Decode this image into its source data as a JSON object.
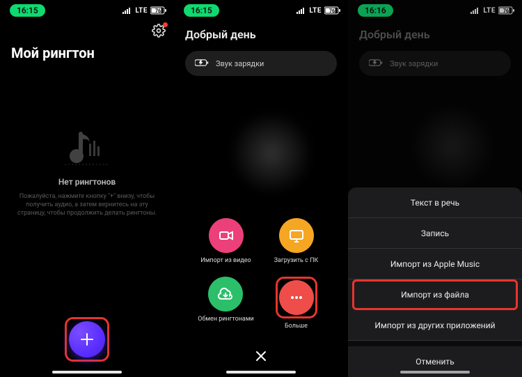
{
  "status": {
    "time_s1": "16:15",
    "time_s2": "16:15",
    "time_s3": "16:16",
    "signal": "••••",
    "net": "LTE",
    "battery": "76"
  },
  "screen1": {
    "title": "Мой рингтон",
    "empty_title": "Нет рингтонов",
    "empty_body": "Пожалуйста, нажмите кнопку \"+\" внизу, чтобы получить аудио, а затем вернитесь на эту страницу, чтобы продолжить делать рингтоны."
  },
  "screen2": {
    "greeting": "Добрый день",
    "chip_label": "Звук зарядки",
    "actions": {
      "video": "Импорт из видео",
      "pc": "Загрузить с ПК",
      "share": "Обмен рингтонами",
      "more": "Больше"
    }
  },
  "screen3": {
    "greeting": "Добрый день",
    "chip_label": "Звук зарядки",
    "sheet": {
      "tts": "Текст в речь",
      "record": "Запись",
      "apple_music": "Импорт из Apple Music",
      "file": "Импорт из файла",
      "other_apps": "Импорт из других приложений",
      "cancel": "Отменить"
    }
  }
}
